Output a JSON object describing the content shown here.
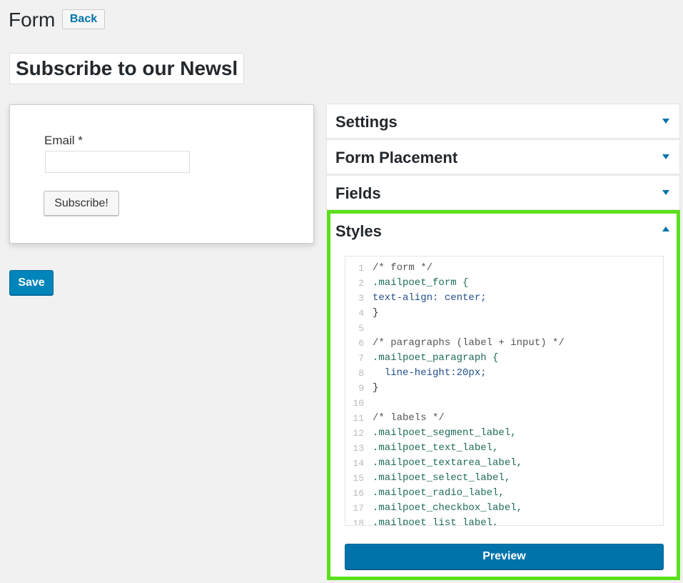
{
  "header": {
    "title": "Form",
    "back_label": "Back"
  },
  "form_title": {
    "value": "Subscribe to our Newsletter"
  },
  "form_preview": {
    "email_label": "Email *",
    "email_value": "",
    "subscribe_label": "Subscribe!"
  },
  "save_label": "Save",
  "panels": {
    "settings": "Settings",
    "form_placement": "Form Placement",
    "fields": "Fields",
    "styles": "Styles"
  },
  "styles_editor": {
    "line_numbers": [
      "1",
      "2",
      "3",
      "4",
      "5",
      "6",
      "7",
      "8",
      "9",
      "10",
      "11",
      "12",
      "13",
      "14",
      "15",
      "16",
      "17",
      "18"
    ],
    "lines": [
      "/* form */",
      ".mailpoet_form {",
      "text-align: center;",
      "}",
      "",
      "/* paragraphs (label + input) */",
      ".mailpoet_paragraph {",
      "  line-height:20px;",
      "}",
      "",
      "/* labels */",
      ".mailpoet_segment_label,",
      ".mailpoet_text_label,",
      ".mailpoet_textarea_label,",
      ".mailpoet_select_label,",
      ".mailpoet_radio_label,",
      ".mailpoet_checkbox_label,",
      ".mailpoet_list_label,"
    ]
  },
  "preview_label": "Preview",
  "colors": {
    "accent": "#0073aa",
    "highlight_border": "#5be01d",
    "background": "#f1f1f1"
  },
  "icons": {
    "collapsed": "caret-down-icon",
    "expanded": "caret-up-icon"
  }
}
